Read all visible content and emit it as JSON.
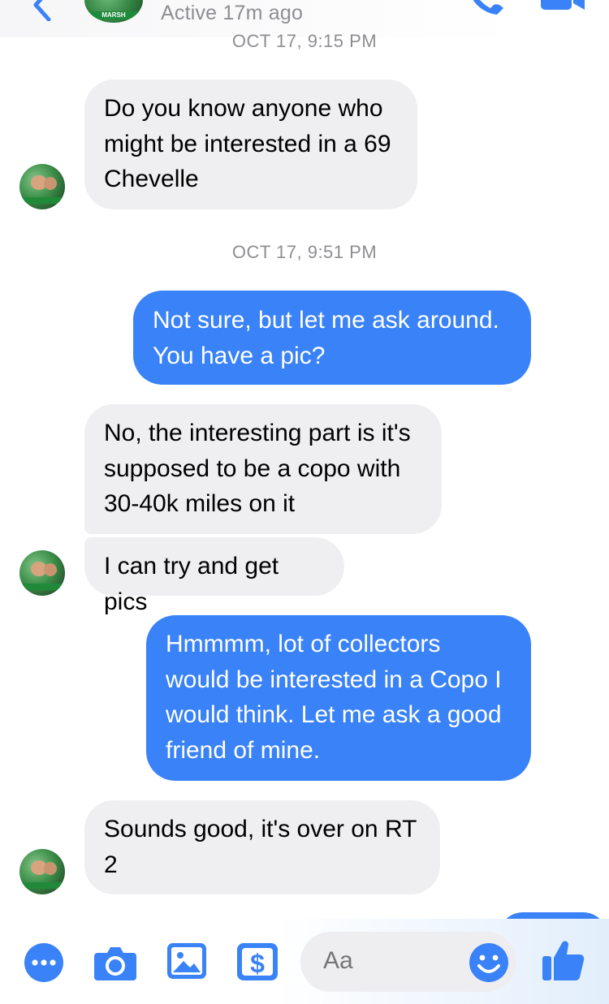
{
  "header": {
    "status": "Active 17m ago",
    "avatar_label": "MARSH"
  },
  "timestamps": [
    "OCT 17, 9:15 PM",
    "OCT 17, 9:51 PM"
  ],
  "messages": [
    {
      "direction": "incoming",
      "text": "Do you know anyone who\nmight be interested in a 69\nChevelle"
    },
    {
      "direction": "outgoing",
      "text": "Not sure, but let me ask around.\nYou have a pic?"
    },
    {
      "direction": "incoming",
      "text": "No, the interesting part is it's\nsupposed to be a copo with\n30-40k miles on it"
    },
    {
      "direction": "incoming",
      "text": "I can try and get pics"
    },
    {
      "direction": "outgoing",
      "text": "Hmmmm, lot of collectors\nwould be interested in a Copo I\nwould think. Let me ask a good\nfriend of mine."
    },
    {
      "direction": "incoming",
      "text": "Sounds good, it's over on RT\n2"
    }
  ],
  "composer": {
    "placeholder": "Aa"
  },
  "toolbar": {
    "icons": [
      "more-icon",
      "camera-icon",
      "photo-icon",
      "payment-icon",
      "emoji-icon",
      "like-icon"
    ]
  },
  "colors": {
    "accent": "#3a82f7",
    "incoming_bubble": "#efeff1",
    "muted_text": "#8e8e93"
  }
}
